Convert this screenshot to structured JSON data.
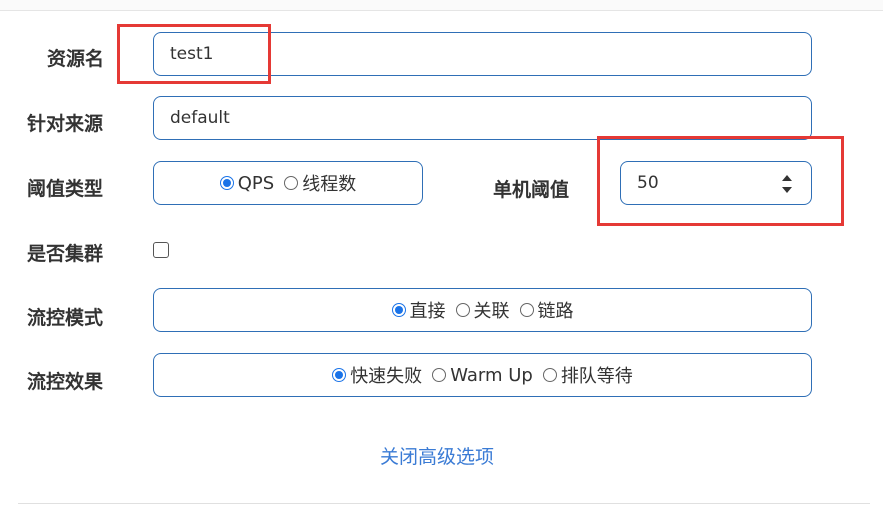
{
  "form": {
    "resource_name": {
      "label": "资源名",
      "value": "test1"
    },
    "limit_app": {
      "label": "针对来源",
      "value": "default"
    },
    "threshold_type": {
      "label": "阈值类型",
      "options": [
        "QPS",
        "线程数"
      ],
      "selected": "QPS"
    },
    "single_threshold": {
      "label": "单机阈值",
      "value": "50"
    },
    "cluster_mode": {
      "label": "是否集群",
      "checked": false
    },
    "strategy": {
      "label": "流控模式",
      "options": [
        "直接",
        "关联",
        "链路"
      ],
      "selected": "直接"
    },
    "control_behavior": {
      "label": "流控效果",
      "options": [
        "快速失败",
        "Warm Up",
        "排队等待"
      ],
      "selected": "快速失败"
    },
    "toggle_advanced": "关闭高级选项"
  },
  "colors": {
    "accent": "#1a73e8",
    "border": "#2f6fb6",
    "link": "#3a7bd5",
    "highlight": "#e53935"
  }
}
